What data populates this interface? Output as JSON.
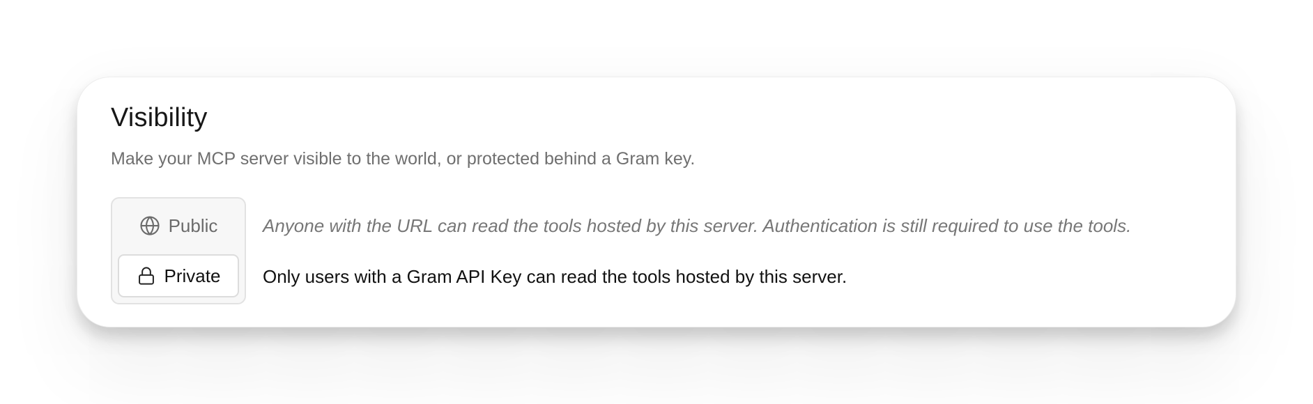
{
  "visibility": {
    "title": "Visibility",
    "subtitle": "Make your MCP server visible to the world, or protected behind a Gram key.",
    "selected": "private",
    "options": [
      {
        "icon": "globe-icon",
        "label": "Public",
        "description": "Anyone with the URL can read the tools hosted by this server. Authentication is still required to use the tools."
      },
      {
        "icon": "lock-icon",
        "label": "Private",
        "description": "Only users with a Gram API Key can read the tools hosted by this server."
      }
    ]
  }
}
